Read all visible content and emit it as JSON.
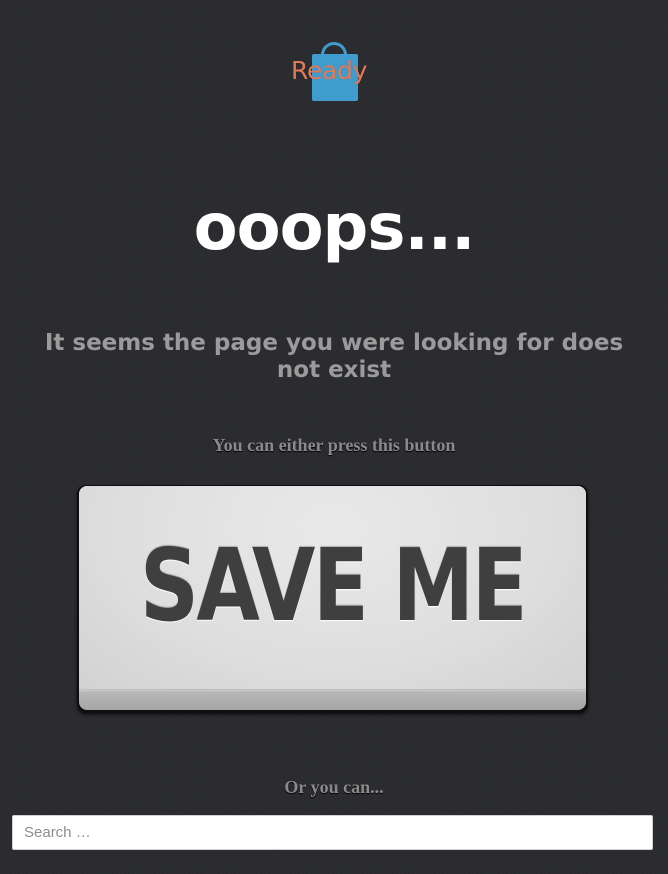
{
  "logo": {
    "text": "Ready",
    "icon": "shopping-bag-icon",
    "text_color": "#e07a58",
    "bag_color": "#3f9ccf"
  },
  "headline": "ooops...",
  "message": "It seems the page you were looking for does not exist",
  "prompt_button": "You can either press this button",
  "save_button": {
    "label": "SAVE ME"
  },
  "prompt_search": "Or you can...",
  "search": {
    "placeholder": "Search …",
    "value": ""
  },
  "colors": {
    "background": "#2b2c30",
    "headline": "#ffffff",
    "message": "#9b9b9b"
  }
}
